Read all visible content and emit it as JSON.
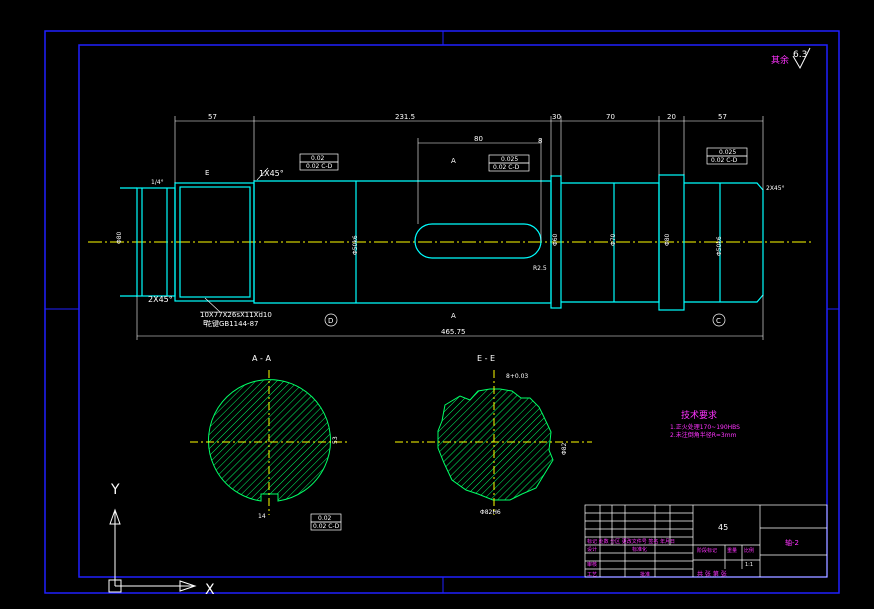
{
  "colors": {
    "background": "#000000",
    "border": "#2020ff",
    "outline": "#00ffff",
    "text": "#ffffff",
    "dims": "#ffffff",
    "hatch": "#00ff66",
    "centerline": "#ffff00",
    "magenta": "#ff33ff",
    "title_block": "#ffffff"
  },
  "roughness": {
    "label": "其余",
    "value": "6.3"
  },
  "top_dims": {
    "d57a": "57",
    "d2315": "231.5",
    "d30": "30",
    "d70": "70",
    "d20": "20",
    "d57b": "57",
    "d80": "80",
    "d8": "8",
    "total": "465.75"
  },
  "callouts": {
    "chamfer_left": "1X45°",
    "chamfer_bottom": "2X45°",
    "chamfer_right": "2X45°",
    "angle": "1/4°",
    "radius": "R2.5",
    "spline": "10X77X26sX11Xd10",
    "spline_std": "花键GB1144-87"
  },
  "diam_labels": {
    "d1": "Φ80",
    "d2": "Φ50k6",
    "d3": "Φ60",
    "d4": "Φ70",
    "d5": "Φ80",
    "d6": "Φ50k6"
  },
  "tolerance_frames": {
    "f1a": "0.02",
    "f1b": "0.02 C-D",
    "f2a": "0.025",
    "f2b": "0.02 C-D",
    "f3a": "0.025",
    "f3b": "0.02 C-D",
    "f4a": "0.02",
    "f4b": "0.02 C-D"
  },
  "datums": {
    "d": "D",
    "c": "C"
  },
  "section_labels": {
    "a_top": "A",
    "a_bottom": "A",
    "e_top": "E",
    "e_bottom": "E",
    "view_aa": "A - A",
    "view_ee": "E - E"
  },
  "section_dims": {
    "keyway_w": "14",
    "keyway_t": "53",
    "spline_od": "Φ82",
    "spline_id": "Φ82H6",
    "spline_top": "8+0.03"
  },
  "tech": {
    "title": "技术要求",
    "line1": "1.正火处理170~190HBS",
    "line2": "2.未注倒角半径R=3mm"
  },
  "title_block": {
    "material": "45",
    "drawing_no": "轴-2",
    "row_a": "标记 处数 分区 更改文件号 签名 年月日",
    "design": "设计",
    "std": "标准化",
    "check": "审核",
    "process": "工艺",
    "approve": "批准",
    "stage": "阶段标记",
    "weight": "重量",
    "scale": "比例",
    "scale_val": "1:1",
    "sheet": "共 张 第 张"
  },
  "axes": {
    "x": "X",
    "y": "Y"
  }
}
